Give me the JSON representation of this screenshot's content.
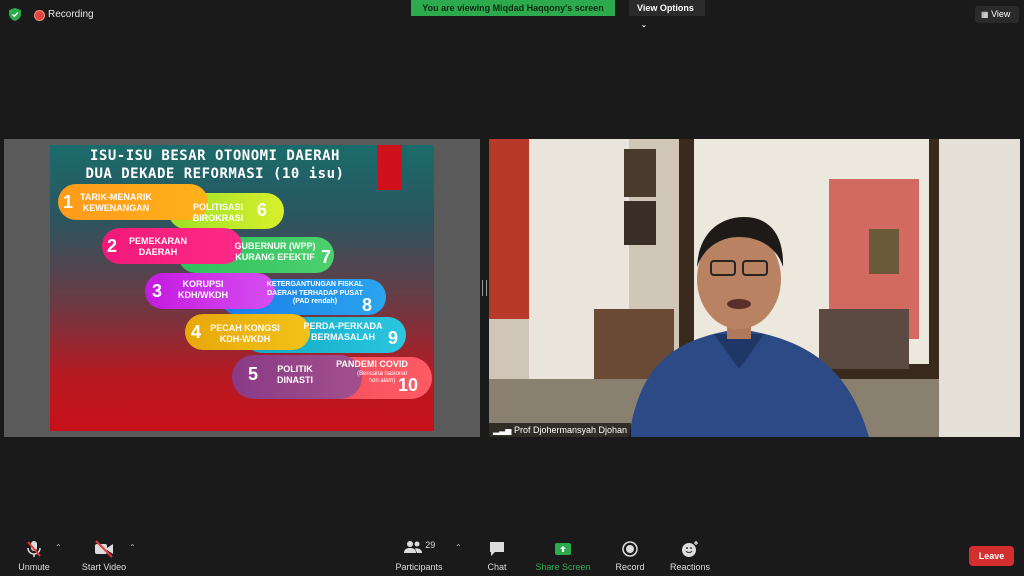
{
  "top_bar": {
    "recording_label": "Recording",
    "banner_text": "You are viewing Miqdad Haqqony's screen",
    "view_options_label": "View Options",
    "view_label": "View"
  },
  "slide": {
    "title_line1": "ISU-ISU BESAR OTONOMI DAERAH",
    "title_line2": "DUA DEKADE REFORMASI (10 isu)",
    "issues": [
      {
        "num": "1",
        "text": "TARIK-MENARIK\nKEWENANGAN"
      },
      {
        "num": "2",
        "text": "PEMEKARAN\nDAERAH"
      },
      {
        "num": "3",
        "text": "KORUPSI\nKDH/WKDH"
      },
      {
        "num": "4",
        "text": "PECAH KONGSI\nKDH-WKDH"
      },
      {
        "num": "5",
        "text": "POLITIK\nDINASTI"
      },
      {
        "num": "6",
        "text": "POLITISASI\nBIROKRASI"
      },
      {
        "num": "7",
        "text": "GUBERNUR (WPP)\nKURANG EFEKTIF"
      },
      {
        "num": "8",
        "text": "KETERGANTUNGAN FISKAL\nDAERAH TERHADAP PUSAT\n(PAD rendah)"
      },
      {
        "num": "9",
        "text": "PERDA-PERKADA\nBERMASALAH"
      },
      {
        "num": "10",
        "text": "PANDEMI COVID",
        "subtext": "(Bencana nasional\nnon alam)"
      }
    ]
  },
  "video": {
    "participant_name": "Prof Djohermansyah Djohan"
  },
  "toolbar": {
    "unmute_label": "Unmute",
    "start_video_label": "Start Video",
    "participants_label": "Participants",
    "participants_count": "29",
    "chat_label": "Chat",
    "share_screen_label": "Share Screen",
    "record_label": "Record",
    "reactions_label": "Reactions",
    "leave_label": "Leave"
  },
  "colors": {
    "banner_green": "#2eaa4e",
    "share_green": "#2eaa4e",
    "leave_red": "#d32f2f",
    "recording_red": "#e0463f"
  }
}
